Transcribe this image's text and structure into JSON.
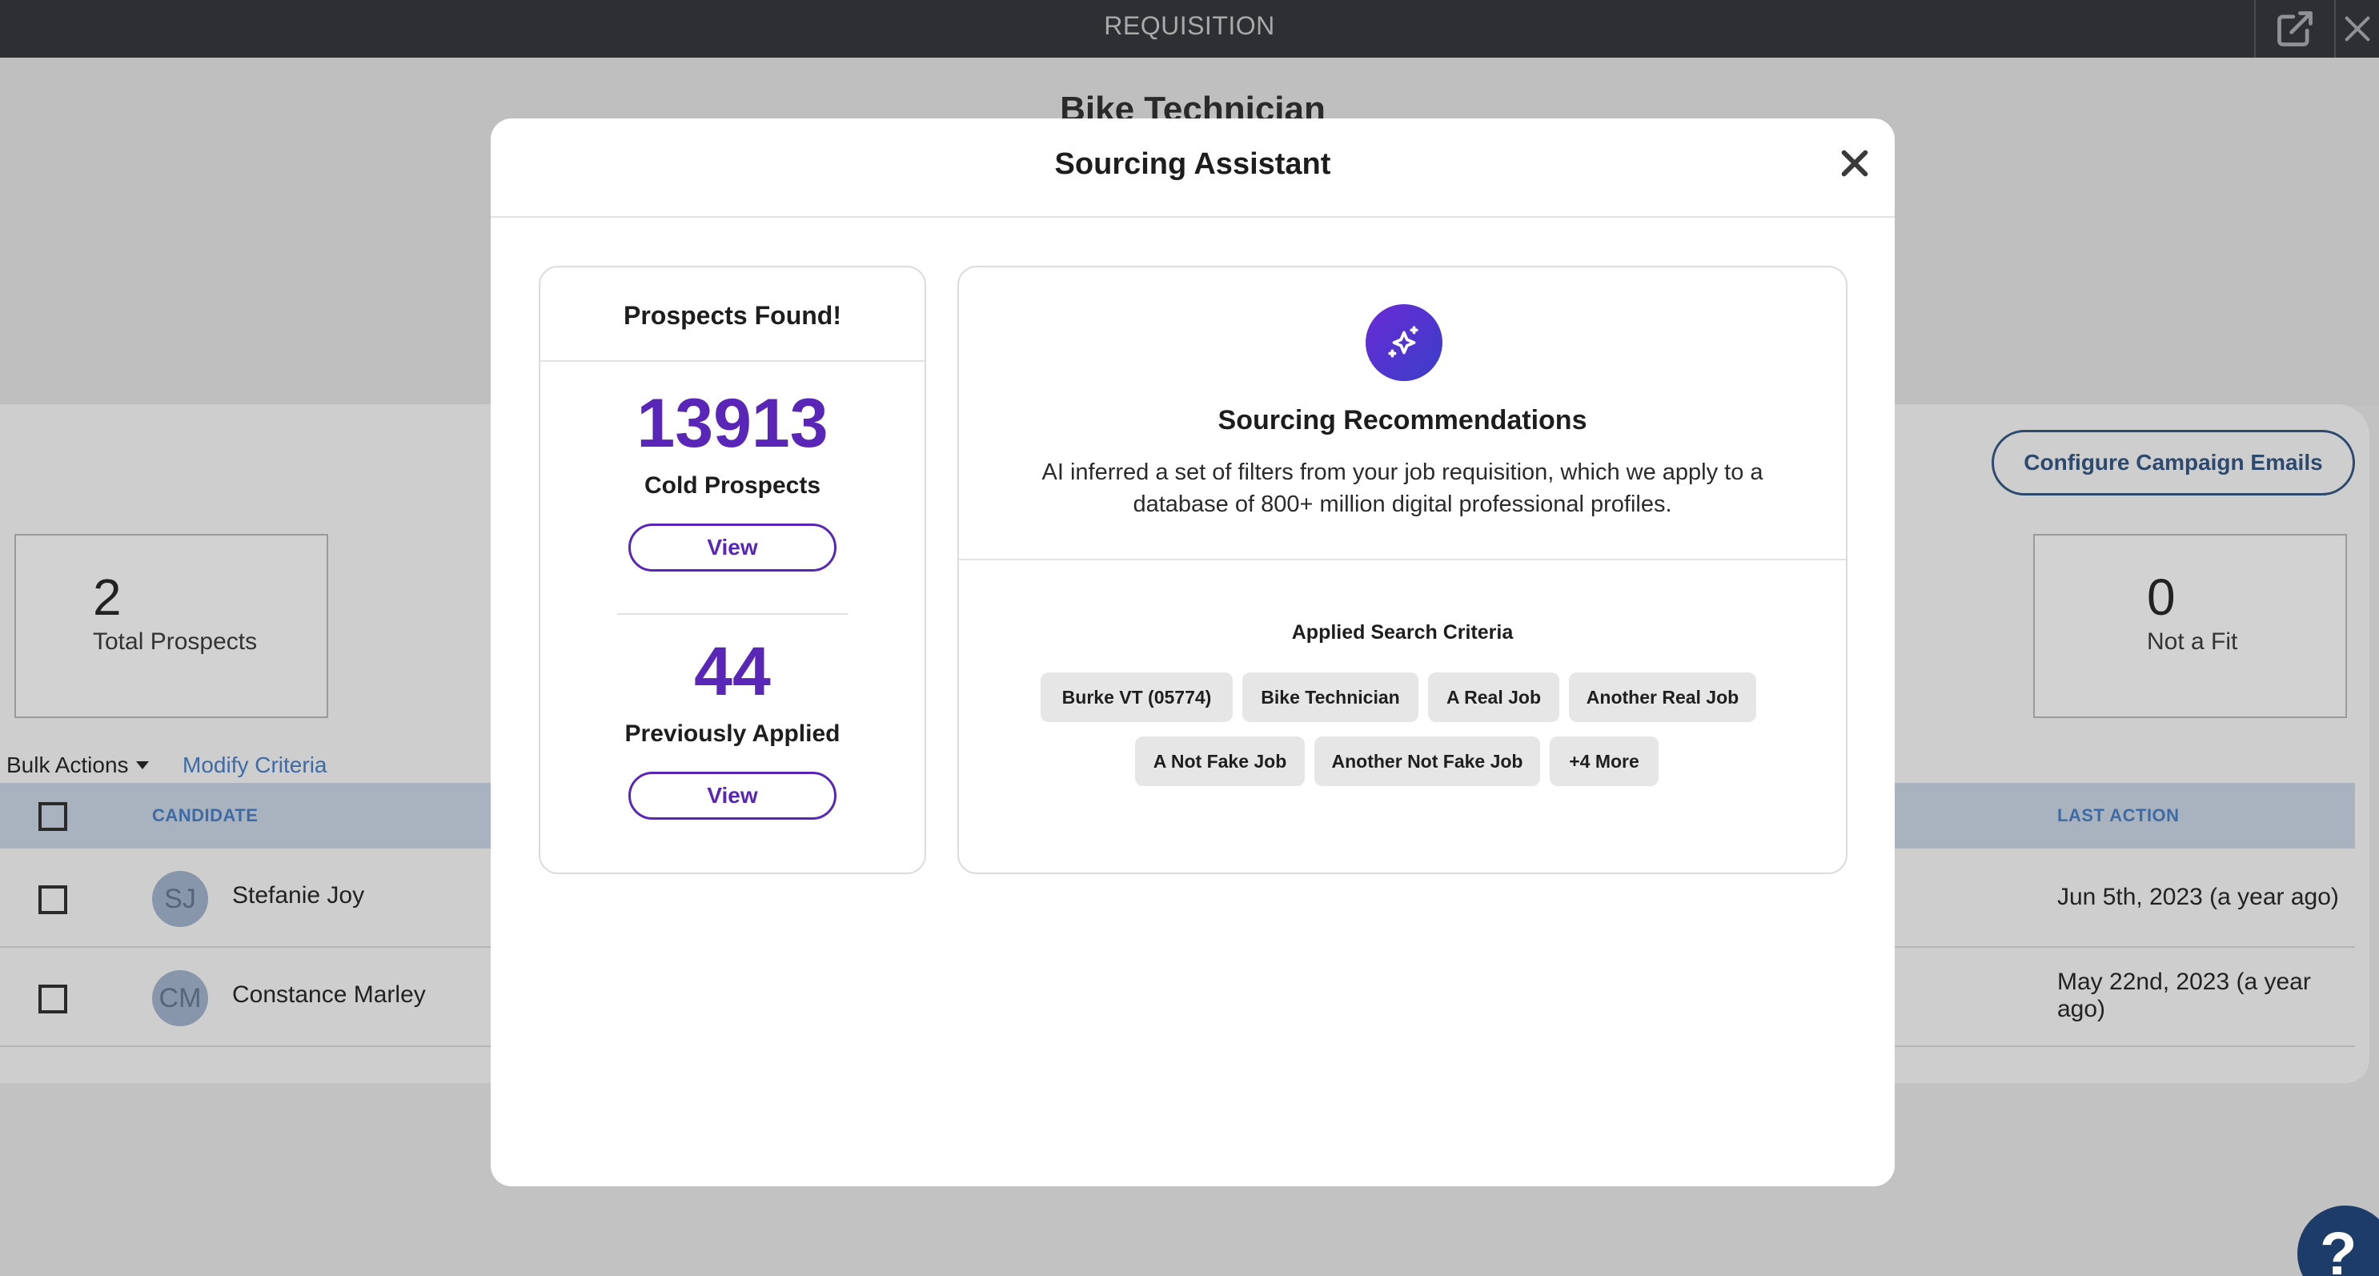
{
  "app": {
    "window_title": "REQUISITION",
    "job_title": "Bike Technician",
    "configure_button": "Configure Campaign Emails",
    "stats": {
      "total_prospects": {
        "value": "2",
        "label": "Total Prospects"
      },
      "not_a_fit": {
        "value": "0",
        "label": "Not a Fit"
      }
    },
    "bulk_actions": "Bulk Actions",
    "modify_criteria": "Modify Criteria",
    "table": {
      "headers": {
        "candidate": "CANDIDATE",
        "last_action": "LAST ACTION"
      },
      "rows": [
        {
          "initials": "SJ",
          "name": "Stefanie Joy",
          "last_action": "Jun 5th, 2023 (a year ago)"
        },
        {
          "initials": "CM",
          "name": "Constance Marley",
          "last_action": "May 22nd, 2023 (a year ago)"
        }
      ]
    },
    "help": "?"
  },
  "modal": {
    "title": "Sourcing Assistant",
    "prospects": {
      "title": "Prospects Found!",
      "cold_count": "13913",
      "cold_label": "Cold Prospects",
      "applied_count": "44",
      "applied_label": "Previously Applied",
      "view_label": "View"
    },
    "recommendations": {
      "title": "Sourcing Recommendations",
      "description": "AI inferred a set of filters from your job requisition, which we apply to a database of 800+ million digital professional profiles.",
      "criteria_title": "Applied Search Criteria",
      "chips": [
        "Burke VT (05774)",
        "Bike Technician",
        "A Real Job",
        "Another Real Job",
        "A Not Fake Job",
        "Another Not Fake Job",
        "+4 More"
      ]
    }
  },
  "colors": {
    "accent_purple": "#5a26b8",
    "link_blue": "#3e6aa5",
    "topbar": "#2d2f32",
    "navy": "#1d3c6a"
  },
  "icons": [
    "external-link-icon",
    "close-icon",
    "sparkle-icon",
    "caret-down-icon",
    "help-icon"
  ]
}
